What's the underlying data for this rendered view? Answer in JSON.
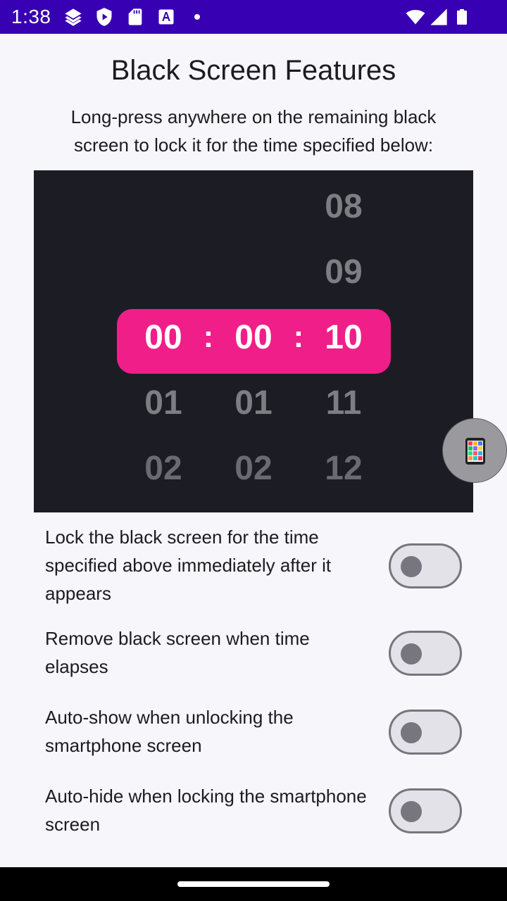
{
  "status_bar": {
    "time": "1:38",
    "left_icons": [
      "layers-icon",
      "shield-play-icon",
      "sd-card-icon",
      "font-a-icon",
      "notification-dot-icon"
    ],
    "right_icons": [
      "wifi-icon",
      "signal-icon",
      "battery-icon"
    ]
  },
  "header": {
    "title": "Black Screen Features",
    "description": "Long-press anywhere on the remaining black screen to lock it for the time specified below:"
  },
  "time_picker": {
    "hours": {
      "selected": "00",
      "below": [
        "01",
        "02"
      ]
    },
    "minutes": {
      "selected": "00",
      "below": [
        "01",
        "02"
      ]
    },
    "seconds": {
      "above": [
        "08",
        "09"
      ],
      "selected": "10",
      "below": [
        "11",
        "12"
      ]
    },
    "separator": ":",
    "highlight_color": "#f01e88",
    "background_color": "#1b1c24"
  },
  "floating_button": {
    "icon": "color-palette-phone-icon"
  },
  "settings": [
    {
      "label": "Lock the black screen for the time specified above immediately after it appears",
      "enabled": false
    },
    {
      "label": "Remove black screen when time elapses",
      "enabled": false
    },
    {
      "label": "Auto-show when unlocking the smartphone screen",
      "enabled": false
    },
    {
      "label": "Auto-hide when locking the smartphone screen",
      "enabled": false
    }
  ],
  "colors": {
    "status_bar": "#3700b3",
    "page_background": "#f7f6fb"
  }
}
